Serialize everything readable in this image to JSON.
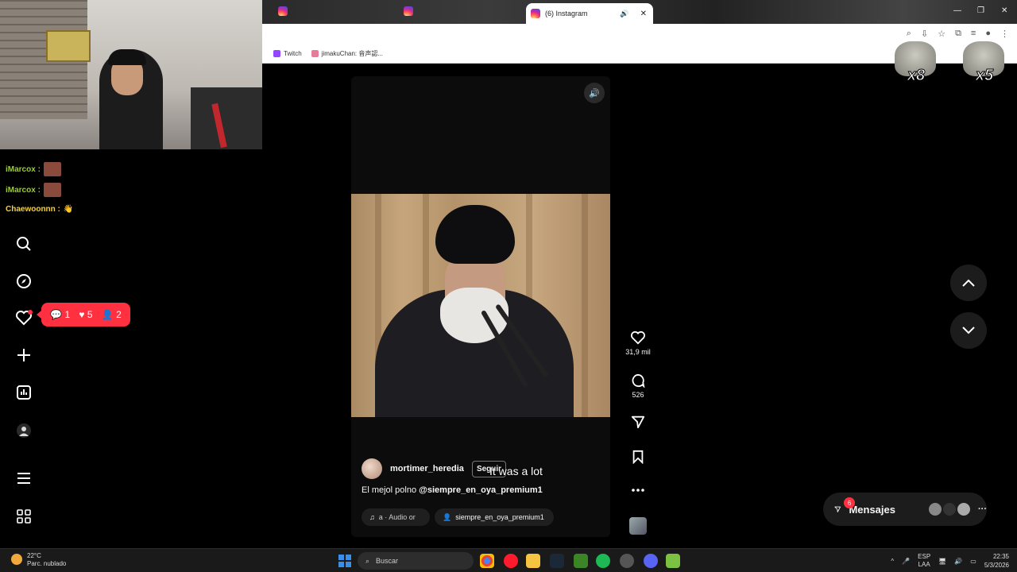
{
  "browser": {
    "active_tab_title": "(6) Instagram",
    "bookmarks": [
      "Twitch",
      "jimakuChan: 音声認..."
    ]
  },
  "stream_chat": [
    {
      "user": "iMarcox :"
    },
    {
      "user": "iMarcox :"
    },
    {
      "user": "Chaewoonnn :"
    }
  ],
  "overlays": {
    "multiplier_1": "x8",
    "multiplier_2": "x5"
  },
  "instagram": {
    "notifications": {
      "comments": "1",
      "likes": "5",
      "follows": "2"
    },
    "reel": {
      "likes_count": "31,9 mil",
      "comments_count": "526",
      "username": "mortimer_heredia",
      "follow_label": "Seguir",
      "subtitle": "It was a lot",
      "caption_text": "El mejol polno",
      "caption_mention": "@siempre_en_oya_premium1",
      "audio_label": "a · Audio or",
      "tagged_user": "siempre_en_oya_premium1"
    },
    "messages": {
      "label": "Mensajes",
      "badge": "6"
    }
  },
  "taskbar": {
    "temperature": "22°C",
    "weather_desc": "Parc. nublado",
    "search_placeholder": "Buscar",
    "lang_1": "ESP",
    "lang_2": "LAA",
    "time": "22:35",
    "date": "5/3/2026"
  },
  "colors": {
    "accent_red": "#ff3040",
    "bg": "#000000",
    "windows_blue": "#3a8ee6"
  }
}
